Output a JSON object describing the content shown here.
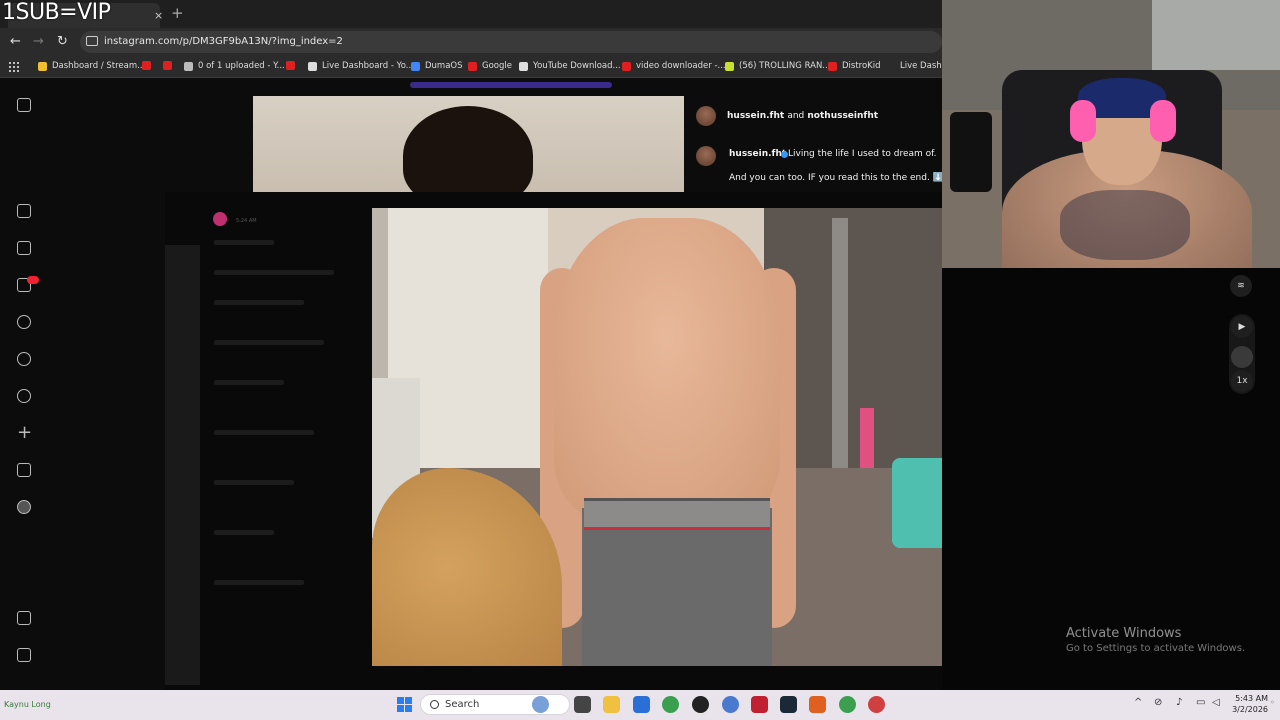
{
  "overlay": {
    "text": "1SUB=VIP"
  },
  "browser": {
    "tab_close": "×",
    "tab_new": "+",
    "back": "←",
    "forward": "→",
    "reload": "↻",
    "url": "instagram.com/p/DM3GF9bA13N/?img_index=2",
    "bookmarks": [
      {
        "label": "Dashboard / Stream...",
        "color": "#f0c030"
      },
      {
        "label": "",
        "color": "#e02020"
      },
      {
        "label": "0 of 1 uploaded - Y...",
        "color": "#e02020"
      },
      {
        "label": "",
        "color": "#bbbbbb"
      },
      {
        "label": "Live Dashboard - Yo...",
        "color": "#e02020"
      },
      {
        "label": "DumaOS",
        "color": "#dddddd"
      },
      {
        "label": "Google",
        "color": "#4285f4"
      },
      {
        "label": "YouTube Download...",
        "color": "#e02020"
      },
      {
        "label": "video downloader -...",
        "color": "#dddddd"
      },
      {
        "label": "(56) TROLLING RAN...",
        "color": "#e02020"
      },
      {
        "label": "DistroKid",
        "color": "#c8e030"
      },
      {
        "label": "Live Dashb",
        "color": "#e02020"
      }
    ]
  },
  "post": {
    "likes_line_user1": "hussein.fht",
    "likes_line_and": "and",
    "likes_line_user2": "nothusseinfht",
    "caption_user": "hussein.fht",
    "caption_text_1": "Living the life I used to dream of.",
    "caption_text_2": "And you can too. IF you read this to the end. ⬇️"
  },
  "chat": {
    "time": "5:24 AM"
  },
  "side_controls": {
    "speed": "1x",
    "play": "▶"
  },
  "watermark": {
    "title": "Activate Windows",
    "subtitle": "Go to Settings to activate Windows."
  },
  "taskbar": {
    "left_text": "Kaynu Long",
    "search": "Search",
    "time": "5:43 AM",
    "date": "3/2/2026",
    "tray_up": "^",
    "apps": [
      {
        "name": "widgets",
        "color": "#7aa0d8"
      },
      {
        "name": "task-view",
        "color": "#444444"
      },
      {
        "name": "file-explorer",
        "color": "#f0c040"
      },
      {
        "name": "store",
        "color": "#2a6fd8"
      },
      {
        "name": "chrome",
        "color": "#3aa050"
      },
      {
        "name": "obs",
        "color": "#222222"
      },
      {
        "name": "chrome-profile",
        "color": "#4a7ad0"
      },
      {
        "name": "acrobat",
        "color": "#c02030"
      },
      {
        "name": "steam",
        "color": "#1b2838"
      },
      {
        "name": "app-orange",
        "color": "#e06020"
      },
      {
        "name": "chrome-2",
        "color": "#3aa050"
      },
      {
        "name": "chrome-3",
        "color": "#d04040"
      }
    ]
  }
}
